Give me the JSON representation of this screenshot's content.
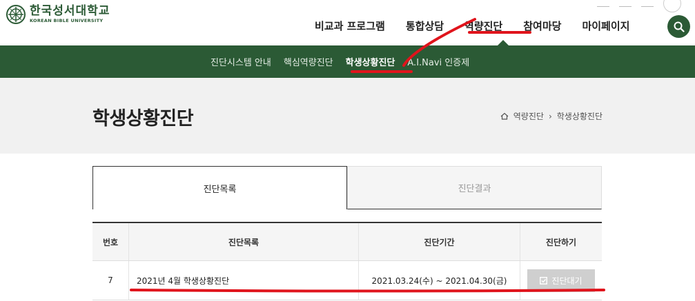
{
  "header": {
    "logo_ko": "한국성서대학교",
    "logo_en": "KOREAN BIBLE UNIVERSITY",
    "gnb": [
      {
        "label": "비교과 프로그램"
      },
      {
        "label": "통합상담"
      },
      {
        "label": "역량진단"
      },
      {
        "label": "참여마당"
      },
      {
        "label": "마이페이지"
      }
    ]
  },
  "subnav": {
    "items": [
      {
        "label": "진단시스템 안내"
      },
      {
        "label": "핵심역량진단"
      },
      {
        "label": "학생상황진단"
      },
      {
        "label": "A.I.Navi 인증제"
      }
    ]
  },
  "page": {
    "title": "학생상황진단",
    "breadcrumb": [
      "역량진단",
      "학생상황진단"
    ]
  },
  "tabs": [
    {
      "label": "진단목록"
    },
    {
      "label": "진단결과"
    }
  ],
  "table": {
    "headers": [
      "번호",
      "진단목록",
      "진단기간",
      "진단하기"
    ],
    "rows": [
      {
        "no": "7",
        "title": "2021년 4월 학생상황진단",
        "period": "2021.03.24(수) ~ 2021.04.30(금)",
        "action": "진단대기"
      }
    ]
  },
  "colors": {
    "brand_green": "#2b5a35",
    "annotation_red": "#e0141c"
  }
}
